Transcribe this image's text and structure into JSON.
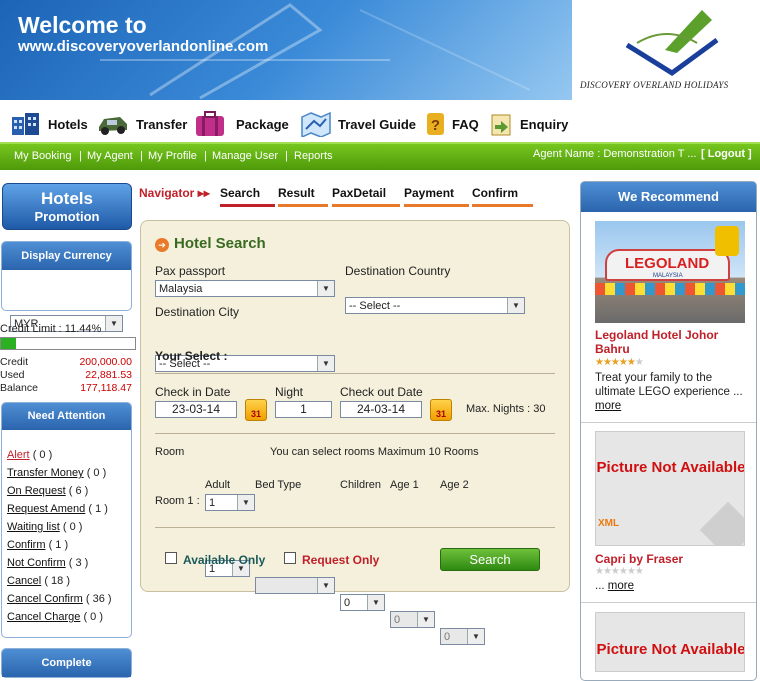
{
  "banner": {
    "welcome": "Welcome to",
    "url": "www.discoveryoverlandonline.com",
    "logo_text": "DISCOVERY OVERLAND HOLIDAYS"
  },
  "topnav": [
    {
      "label": "Hotels",
      "icon": "hotel-building-icon",
      "color": "#2a5fb0"
    },
    {
      "label": "Transfer",
      "icon": "car-icon",
      "color": "#4a6a3a"
    },
    {
      "label": "Package",
      "icon": "suitcase-icon",
      "color": "#c0308a"
    },
    {
      "label": "Travel Guide",
      "icon": "map-icon",
      "color": "#4a86c8"
    },
    {
      "label": "FAQ",
      "icon": "question-icon",
      "color": "#e8b020"
    },
    {
      "label": "Enquiry",
      "icon": "enquiry-icon",
      "color": "#5a9a30"
    }
  ],
  "greenbar": {
    "links": [
      "My Booking",
      "My Agent",
      "My Profile",
      "Manage User",
      "Reports"
    ],
    "agent": "Agent Name : Demonstration T ...",
    "logout": "[ Logout ]"
  },
  "left": {
    "promo_title": "Hotels",
    "promo_sub": "Promotion",
    "currency_title": "Display Currency",
    "currency_value": "MYR",
    "credit_limit": "Credit Limit : 11.44%",
    "credit_label": "Credit",
    "credit_value": "200,000.00",
    "used_label": "Used",
    "used_value": "22,881.53",
    "balance_label": "Balance",
    "balance_value": "177,118.47",
    "credit_fraction": 0.1144,
    "attention_title": "Need Attention",
    "attention": [
      {
        "label": "Alert",
        "count": "( 0 )"
      },
      {
        "label": "Transfer Money",
        "count": "( 0 )"
      },
      {
        "label": "On Request",
        "count": "( 6 )"
      },
      {
        "label": "Request Amend",
        "count": "( 1 )"
      },
      {
        "label": "Waiting list",
        "count": "( 0 )"
      },
      {
        "label": "Confirm",
        "count": "( 1 )"
      },
      {
        "label": "Not Confirm",
        "count": "( 3 )"
      },
      {
        "label": "Cancel",
        "count": "( 18 )"
      },
      {
        "label": "Cancel Confirm",
        "count": "( 36 )"
      },
      {
        "label": "Cancel Charge",
        "count": "( 0 )"
      }
    ],
    "complete_title": "Complete"
  },
  "navigator": {
    "label": "Navigator",
    "arrows": "▸▸",
    "tabs": [
      "Search",
      "Result",
      "PaxDetail",
      "Payment",
      "Confirm"
    ]
  },
  "search": {
    "title": "Hotel Search",
    "pax_label": "Pax passport",
    "pax_value": "Malaysia",
    "dest_country_label": "Destination Country",
    "dest_country_value": "-- Select --",
    "dest_city_label": "Destination City",
    "dest_city_value": "-- Select --",
    "your_select": "Your Select :",
    "checkin_label": "Check in Date",
    "checkin_value": "23-03-14",
    "night_label": "Night",
    "night_value": "1",
    "checkout_label": "Check out Date",
    "checkout_value": "24-03-14",
    "max_nights": "Max. Nights : 30",
    "cal_text": "31",
    "room_label": "Room",
    "room_value": "1",
    "room_note": "You can select rooms Maximum 10 Rooms",
    "adult_label": "Adult",
    "bedtype_label": "Bed Type",
    "children_label": "Children",
    "age1_label": "Age 1",
    "age2_label": "Age 2",
    "room1_label": "Room 1 :",
    "adult_value": "1",
    "bedtype_value": "",
    "children_value": "0",
    "age1_value": "0",
    "age2_value": "0",
    "available_only": "Available Only",
    "request_only": "Request Only",
    "search_button": "Search"
  },
  "recommend": {
    "title": "We Recommend",
    "items": [
      {
        "name": "Legoland Hotel Johor Bahru",
        "desc": "Treat your family to the ultimate LEGO experience ...",
        "more": "more",
        "stars": 5
      },
      {
        "name": "Capri by Fraser",
        "desc": "...",
        "more": "more",
        "stars": 0,
        "placeholder": "Picture Not Available",
        "xml": "XML"
      },
      {
        "placeholder": "Picture Not Available"
      }
    ],
    "lego_sign": "LEGOLAND",
    "lego_sub": "MALAYSIA"
  }
}
